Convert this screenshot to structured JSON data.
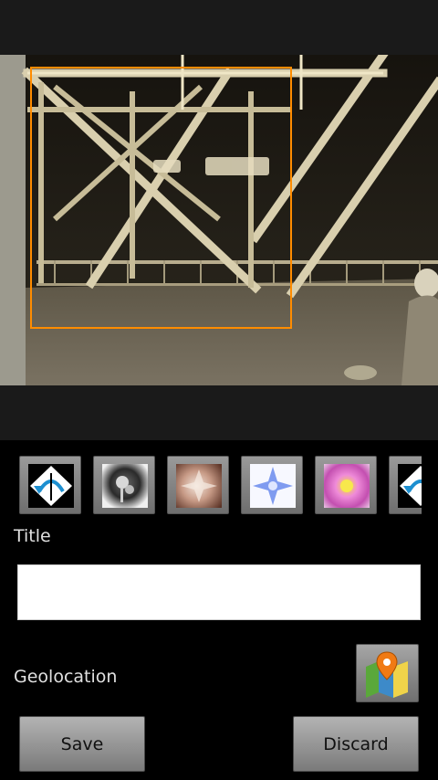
{
  "editor": {
    "preview_alt": "photo preview",
    "colors": {
      "crop_border": "#ff8c00",
      "background": "#000000",
      "strip": "#1a1a1a"
    }
  },
  "filters": [
    {
      "icon": "rotate-left-icon"
    },
    {
      "icon": "vintage-filter-icon"
    },
    {
      "icon": "warm-filter-icon"
    },
    {
      "icon": "blue-tone-filter-icon"
    },
    {
      "icon": "vivid-filter-icon"
    },
    {
      "icon": "rotate-right-icon"
    }
  ],
  "form": {
    "title_label": "Title",
    "title_value": "",
    "title_placeholder": "",
    "geolocation_label": "Geolocation",
    "map_icon": "map-pin-icon"
  },
  "actions": {
    "save_label": "Save",
    "discard_label": "Discard"
  }
}
